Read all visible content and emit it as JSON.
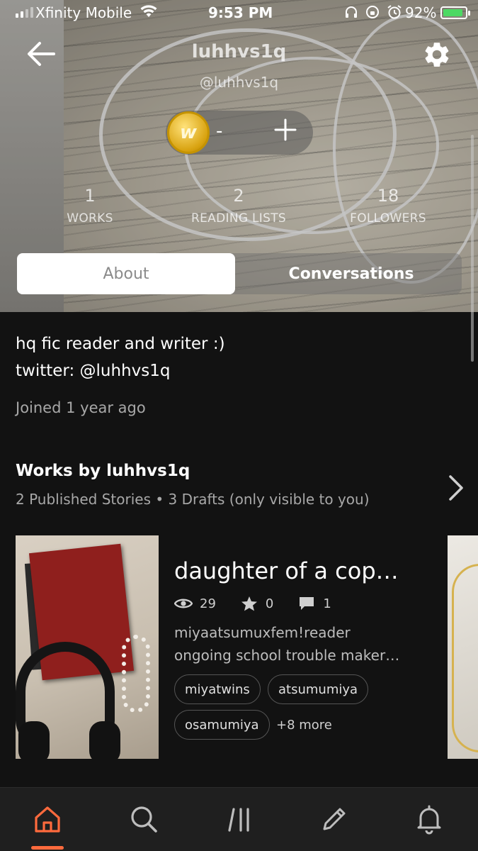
{
  "status_bar": {
    "carrier": "Xfinity Mobile",
    "time": "9:53 PM",
    "battery_percent": "92%",
    "battery_level": 0.92,
    "battery_fill_color": "#4cd964"
  },
  "header": {
    "title": "luhhvs1q",
    "handle": "@luhhvs1q",
    "back_icon": "back-arrow-icon",
    "settings_icon": "gear-icon"
  },
  "coins": {
    "logo_letter": "w",
    "balance": "-",
    "add_icon": "plus-icon"
  },
  "stats": [
    {
      "value": "1",
      "label": "WORKS"
    },
    {
      "value": "2",
      "label": "READING LISTS"
    },
    {
      "value": "18",
      "label": "FOLLOWERS"
    }
  ],
  "tabs": {
    "about": "About",
    "conversations": "Conversations",
    "active": "about"
  },
  "about": {
    "bio_line1": "hq fic reader and writer :)",
    "bio_line2": "twitter: @luhhvs1q",
    "joined": "Joined 1 year ago"
  },
  "works": {
    "heading": "Works by luhhvs1q",
    "subheading": "2 Published Stories • 3 Drafts (only visible to you)",
    "story": {
      "title": "daughter of a cop…",
      "reads": "29",
      "votes": "0",
      "comments": "1",
      "description_line1": "miyaatsumuxfem!reader",
      "description_line2": "ongoing school trouble maker…",
      "tags": [
        "miyatwins",
        "atsumumiya",
        "osamumiya"
      ],
      "more_tags": "+8 more"
    }
  },
  "bottom_nav": {
    "items": [
      "home-icon",
      "search-icon",
      "library-icon",
      "write-icon",
      "notifications-icon"
    ],
    "active": "home",
    "accent_color": "#ff6a3d"
  }
}
